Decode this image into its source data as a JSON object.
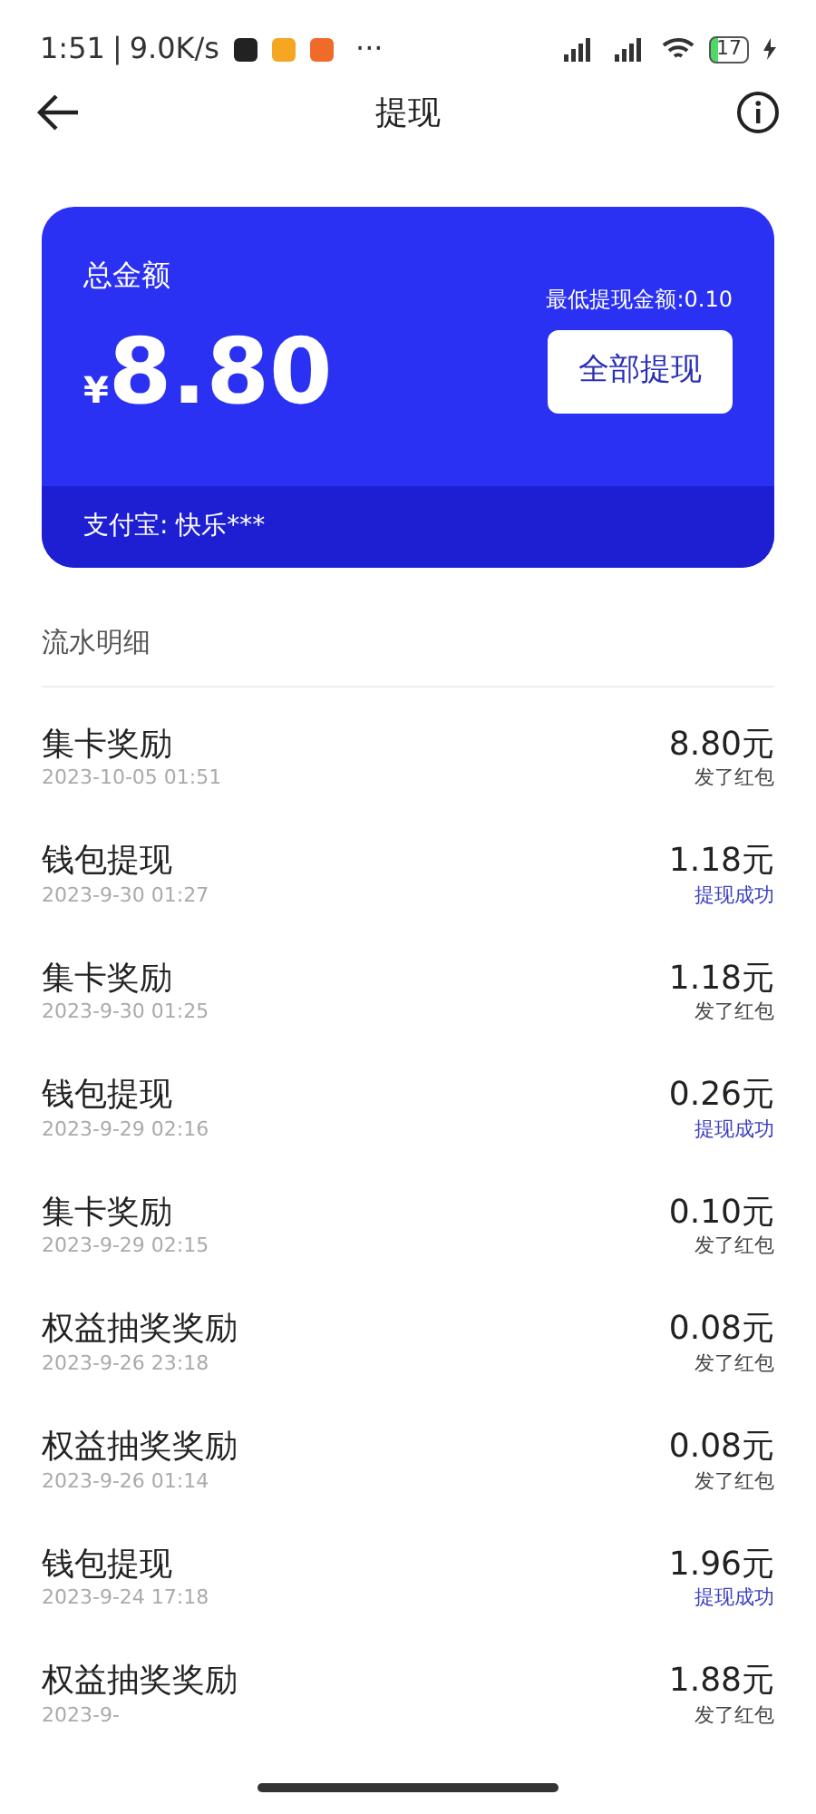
{
  "status_bar": {
    "time": "1:51",
    "separator": "|",
    "speed": "9.0K/s",
    "more": "···",
    "battery": "17"
  },
  "header": {
    "title": "提现"
  },
  "balance_card": {
    "label": "总金额",
    "currency": "¥",
    "amount": "8.80",
    "min_note": "最低提现金额:0.10",
    "button": "全部提现",
    "account": "支付宝: 快乐***"
  },
  "section_title": "流水明细",
  "records": [
    {
      "title": "集卡奖励",
      "time": "2023-10-05 01:51",
      "amount": "8.80元",
      "status": "发了红包",
      "kind": "reward"
    },
    {
      "title": "钱包提现",
      "time": "2023-9-30 01:27",
      "amount": "1.18元",
      "status": "提现成功",
      "kind": "withdrawal"
    },
    {
      "title": "集卡奖励",
      "time": "2023-9-30 01:25",
      "amount": "1.18元",
      "status": "发了红包",
      "kind": "reward"
    },
    {
      "title": "钱包提现",
      "time": "2023-9-29 02:16",
      "amount": "0.26元",
      "status": "提现成功",
      "kind": "withdrawal"
    },
    {
      "title": "集卡奖励",
      "time": "2023-9-29 02:15",
      "amount": "0.10元",
      "status": "发了红包",
      "kind": "reward"
    },
    {
      "title": "权益抽奖奖励",
      "time": "2023-9-26 23:18",
      "amount": "0.08元",
      "status": "发了红包",
      "kind": "reward"
    },
    {
      "title": "权益抽奖奖励",
      "time": "2023-9-26 01:14",
      "amount": "0.08元",
      "status": "发了红包",
      "kind": "reward"
    },
    {
      "title": "钱包提现",
      "time": "2023-9-24 17:18",
      "amount": "1.96元",
      "status": "提现成功",
      "kind": "withdrawal"
    },
    {
      "title": "权益抽奖奖励",
      "time": "2023-9-",
      "amount": "1.88元",
      "status": "发了红包",
      "kind": "reward"
    }
  ]
}
